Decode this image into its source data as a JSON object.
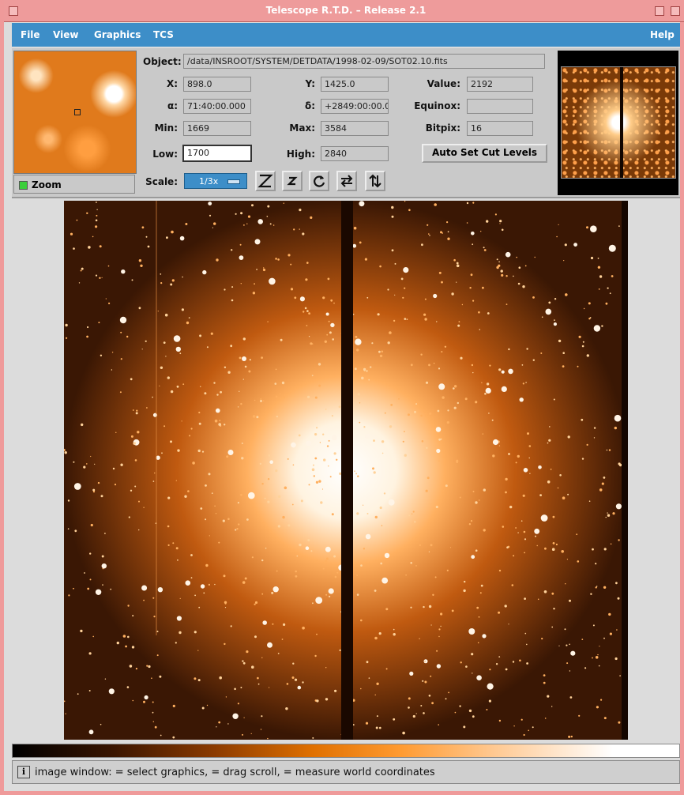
{
  "window": {
    "title": "Telescope R.T.D. – Release 2.1"
  },
  "menu": {
    "items": [
      "File",
      "View",
      "Graphics",
      "TCS"
    ],
    "help": "Help"
  },
  "zoom": {
    "label": "Zoom"
  },
  "info": {
    "object_label": "Object:",
    "object_value": "/data/INSROOT/SYSTEM/DETDATA/1998-02-09/SOT02.10.fits",
    "x_label": "X:",
    "x_value": "898.0",
    "y_label": "Y:",
    "y_value": "1425.0",
    "value_label": "Value:",
    "value_value": "2192",
    "alpha_label": "α:",
    "alpha_value": "71:40:00.000",
    "delta_label": "δ:",
    "delta_value": "+2849:00:00.0",
    "equinox_label": "Equinox:",
    "equinox_value": "",
    "min_label": "Min:",
    "min_value": "1669",
    "max_label": "Max:",
    "max_value": "3584",
    "bitpix_label": "Bitpix:",
    "bitpix_value": "16",
    "low_label": "Low:",
    "low_value": "1700",
    "high_label": "High:",
    "high_value": "2840",
    "auto_cut_label": "Auto Set Cut Levels",
    "scale_label": "Scale:",
    "scale_value": "1/3x"
  },
  "toolbar": {
    "zoom_in_icon": "zoom-in-icon",
    "zoom_out_icon": "zoom-out-icon",
    "rotate_icon": "rotate-icon",
    "flip_x_icon": "flip-x-icon",
    "flip_y_icon": "flip-y-icon"
  },
  "colors": {
    "menu_bg": "#3d8ec8",
    "title_bg": "#ee9b9b",
    "image_accent": "#ff8c20"
  },
  "status": {
    "text": "image window:  = select graphics,  = drag scroll,  = measure world coordinates"
  }
}
